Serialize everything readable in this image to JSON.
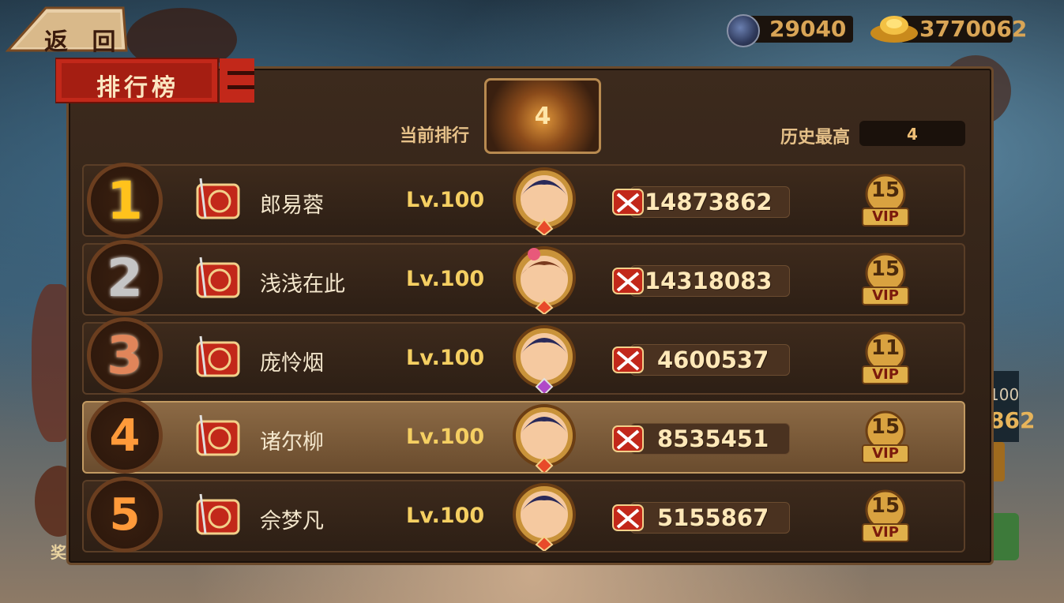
{
  "header": {
    "back_label": "返 回",
    "tab_title": "排行榜"
  },
  "currencies": [
    {
      "icon": "gem-icon",
      "value": "29040"
    },
    {
      "icon": "gold-ingot-icon",
      "value": "3770062"
    }
  ],
  "rank_info": {
    "current_label": "当前排行",
    "current_value": "4",
    "history_label": "历史最高",
    "history_value": "4"
  },
  "rows": [
    {
      "rank": "1",
      "name": "郎易蓉",
      "level": "Lv.100",
      "power": "14873862",
      "vip": "15"
    },
    {
      "rank": "2",
      "name": "浅浅在此",
      "level": "Lv.100",
      "power": "14318083",
      "vip": "15"
    },
    {
      "rank": "3",
      "name": "庞怜烟",
      "level": "Lv.100",
      "power": "4600537",
      "vip": "11"
    },
    {
      "rank": "4",
      "name": "诸尔柳",
      "level": "Lv.100",
      "power": "8535451",
      "vip": "15"
    },
    {
      "rank": "5",
      "name": "佘梦凡",
      "level": "Lv.100",
      "power": "5155867",
      "vip": "15"
    }
  ],
  "vip_label": "VIP",
  "background_text": {
    "level_small": "100",
    "power_partial": "862",
    "button_partial": "奖"
  },
  "colors": {
    "gold": "#f5cf62",
    "highlight_row": "#8c6a45",
    "panel": "#2b1d13"
  }
}
